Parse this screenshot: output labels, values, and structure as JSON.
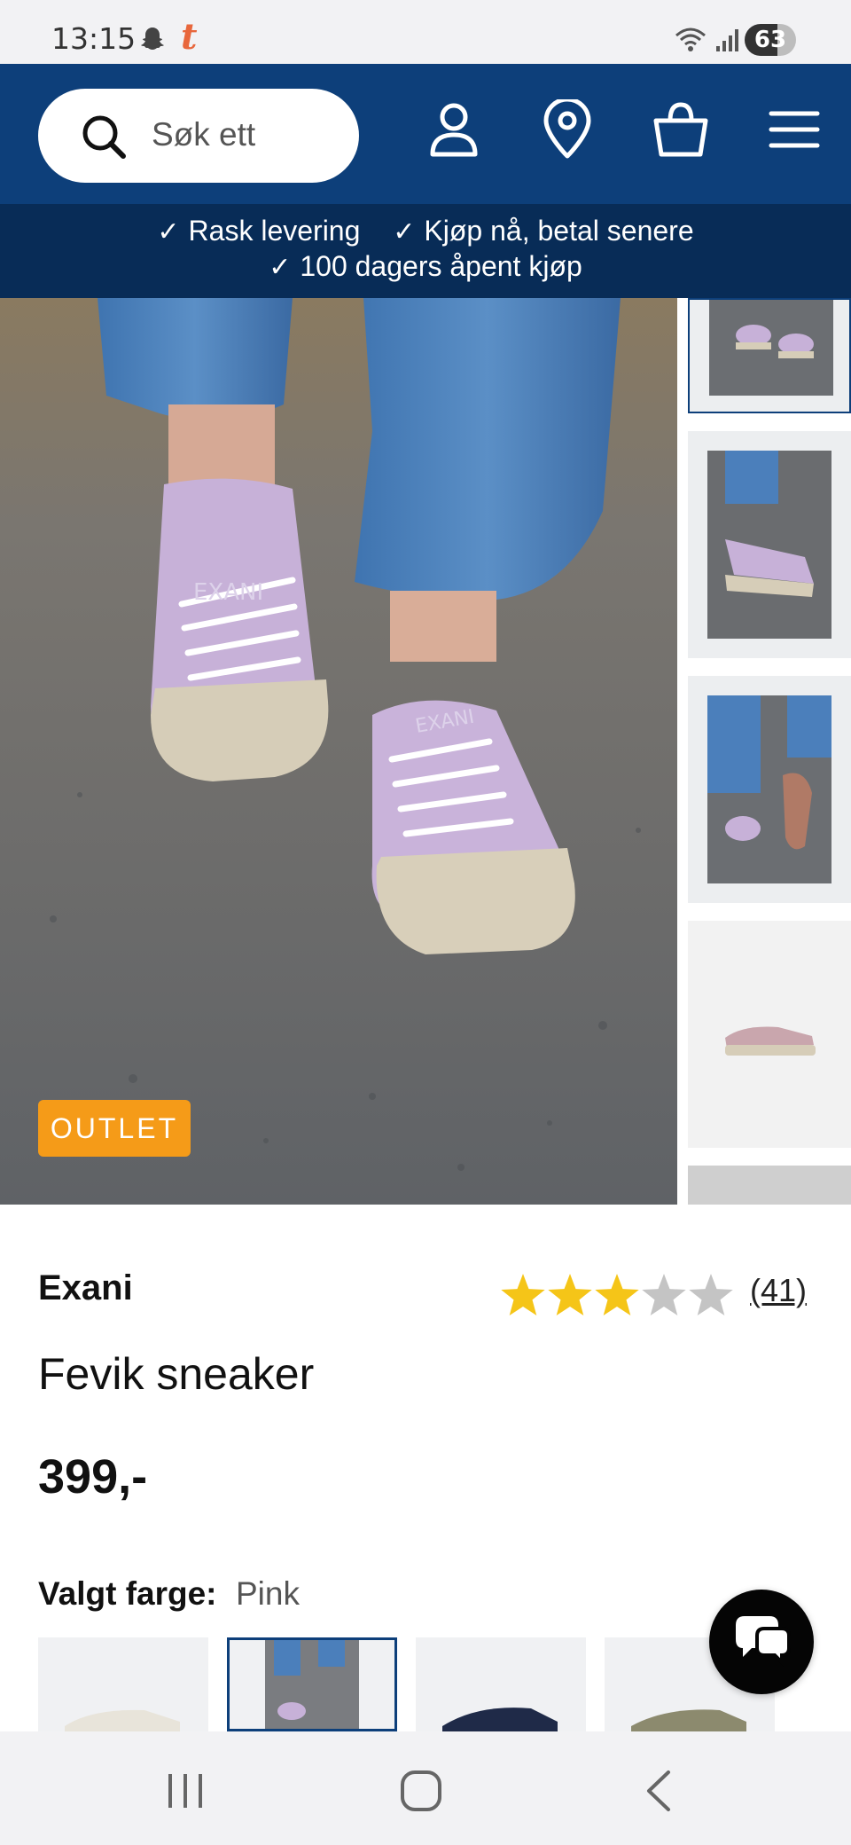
{
  "status_bar": {
    "time": "13:15",
    "battery": "63",
    "battery_level": 0.63,
    "icons": [
      "snapchat-icon",
      "t-app-icon",
      "wifi-icon",
      "signal-icon",
      "battery-icon"
    ]
  },
  "header": {
    "search_placeholder": "Søk ett",
    "icons": [
      "search-icon",
      "account-icon",
      "store-location-icon",
      "cart-icon",
      "menu-icon"
    ]
  },
  "usp": {
    "items": [
      "Rask levering",
      "Kjøp nå, betal senere",
      "100 dagers åpent kjøp"
    ]
  },
  "product": {
    "badge": "OUTLET",
    "brand": "Exani",
    "name": "Fevik sneaker",
    "price": "399,-",
    "rating": 3,
    "rating_max": 5,
    "rating_count": "(41)",
    "color_label": "Valgt farge:",
    "color_value": "Pink",
    "image_logo_text": "EXANI"
  },
  "colors": {
    "accent": "#0d3f7a",
    "usp_bg": "#082c57",
    "badge": "#f59b18",
    "star_filled": "#f5c518",
    "star_empty": "#c4c4c4",
    "shoe": "#c7b1d8"
  },
  "nav_bar": {
    "icons": [
      "recent-apps-icon",
      "home-icon",
      "back-icon"
    ]
  }
}
